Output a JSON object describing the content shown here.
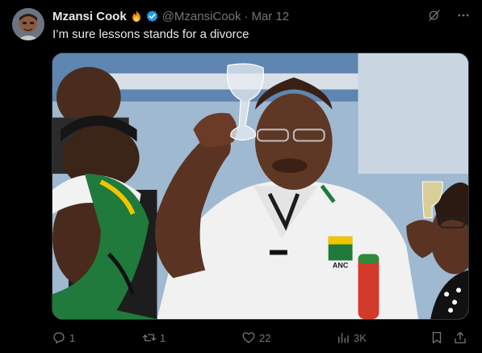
{
  "author": {
    "display_name": "Mzansi Cook",
    "handle": "@MzansiCook",
    "separator": "·",
    "date": "Mar 12",
    "badges": [
      "fire-emoji",
      "verified-badge"
    ]
  },
  "tweet": {
    "text": "I’m sure lessons stands for a divorce"
  },
  "top_icons": [
    "grok-icon",
    "more-icon"
  ],
  "media": {
    "kind": "photo",
    "image_text": "ANC"
  },
  "actions": {
    "replies": "1",
    "reposts": "1",
    "likes": "22",
    "views": "3K"
  },
  "colors": {
    "background": "#000000",
    "primary_text": "#e7e9ea",
    "secondary_text": "#71767b",
    "verified": "#1d9bf0",
    "border": "#2f3336"
  }
}
